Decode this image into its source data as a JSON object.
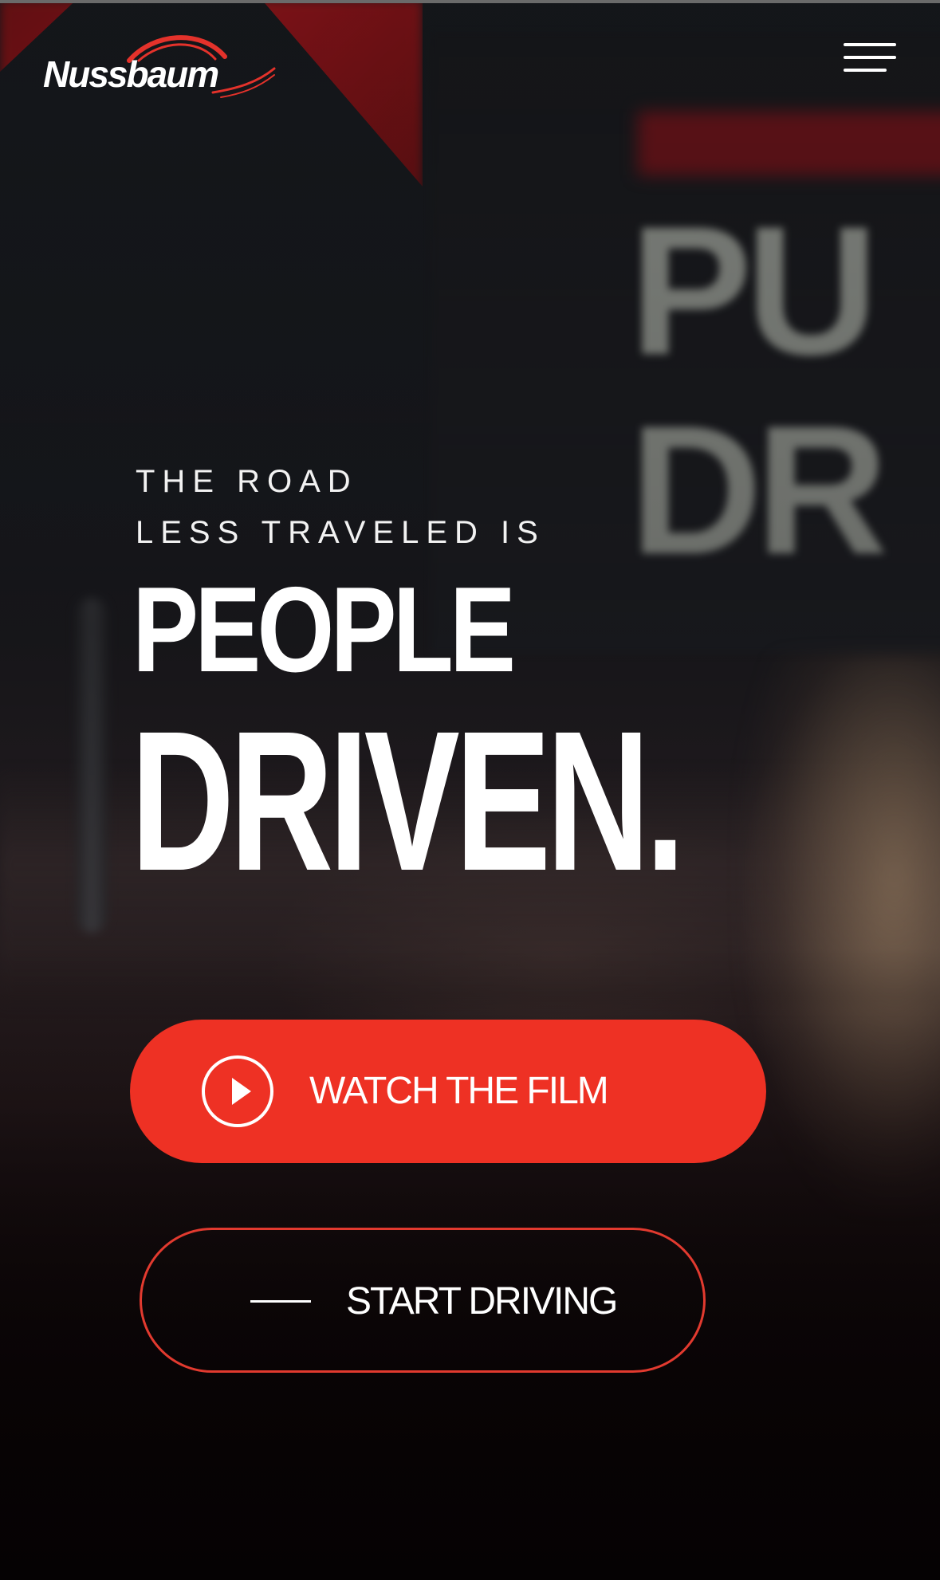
{
  "header": {
    "logo_text": "Nussbaum",
    "menu_icon": "hamburger-menu-icon"
  },
  "hero": {
    "kicker_line_1": "THE ROAD",
    "kicker_line_2": "LESS TRAVELED IS",
    "headline_line_1": "PEOPLE",
    "headline_line_2": "DRIVEN.",
    "background_sign_text": "PU DR"
  },
  "actions": {
    "primary_label": "WATCH THE FILM",
    "primary_icon": "play-circle-icon",
    "secondary_label": "START DRIVING",
    "secondary_icon": "dash-line-icon"
  },
  "colors": {
    "accent": "#ee3124",
    "text": "#ffffff",
    "background": "#0b0708"
  }
}
